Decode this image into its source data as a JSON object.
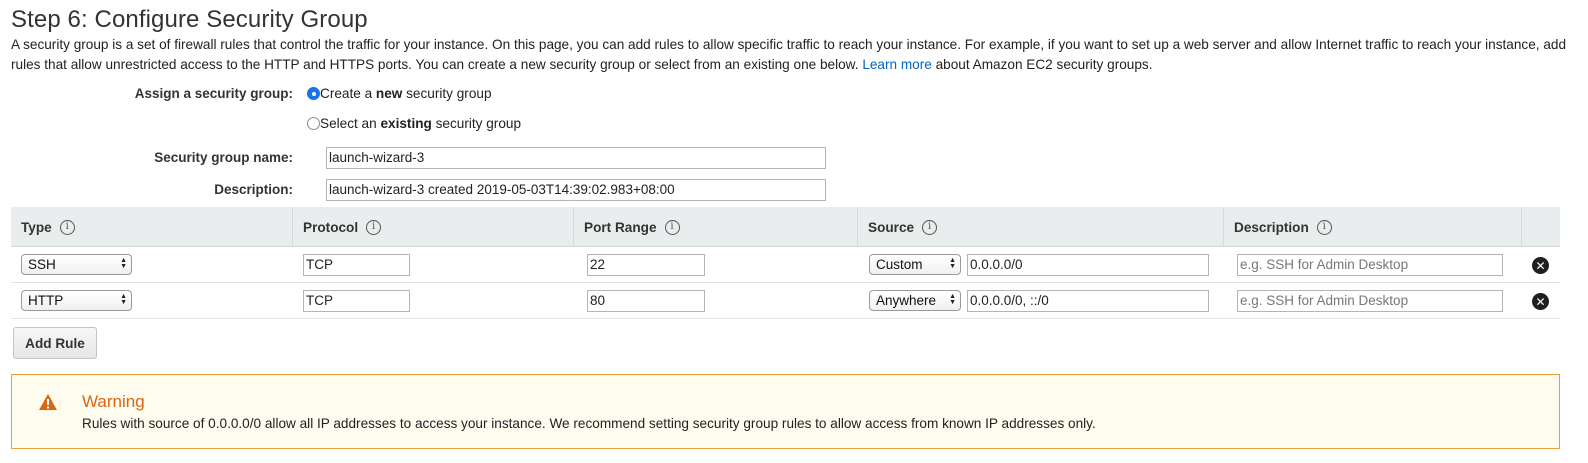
{
  "page": {
    "title": "Step 6: Configure Security Group",
    "intro_text": "A security group is a set of firewall rules that control the traffic for your instance. On this page, you can add rules to allow specific traffic to reach your instance. For example, if you want to set up a web server and allow Internet traffic to reach your instance, add rules that allow unrestricted access to the HTTP and HTTPS ports. You can create a new security group or select from an existing one below.",
    "learn_more_link": "Learn more",
    "intro_suffix": "about Amazon EC2 security groups."
  },
  "form": {
    "assign_label": "Assign a security group:",
    "radio_create_prefix": "Create a ",
    "radio_create_bold": "new",
    "radio_create_suffix": " security group",
    "radio_create_checked": true,
    "radio_existing_prefix": "Select an ",
    "radio_existing_bold": "existing",
    "radio_existing_suffix": " security group",
    "radio_existing_checked": false,
    "name_label": "Security group name:",
    "name_value": "launch-wizard-3",
    "description_label": "Description:",
    "description_value": "launch-wizard-3 created 2019-05-03T14:39:02.983+08:00"
  },
  "table": {
    "headers": {
      "type": "Type",
      "protocol": "Protocol",
      "port_range": "Port Range",
      "source": "Source",
      "description": "Description"
    },
    "info_glyph": "i",
    "rows": [
      {
        "type": "SSH",
        "protocol": "TCP",
        "port_range": "22",
        "source_mode": "Custom",
        "source_value": "0.0.0.0/0",
        "description_placeholder": "e.g. SSH for Admin Desktop"
      },
      {
        "type": "HTTP",
        "protocol": "TCP",
        "port_range": "80",
        "source_mode": "Anywhere",
        "source_value": "0.0.0.0/0, ::/0",
        "description_placeholder": "e.g. SSH for Admin Desktop"
      }
    ],
    "remove_glyph": "✕"
  },
  "add_rule_label": "Add Rule",
  "warning": {
    "title": "Warning",
    "text": "Rules with source of 0.0.0.0/0 allow all IP addresses to access your instance. We recommend setting security group rules to allow access from known IP addresses only.",
    "icon": "warning-triangle-icon",
    "color": "#d86613"
  },
  "colors": {
    "link": "#0066c0",
    "radio_selected": "#1a73e8",
    "table_header_bg": "#eaeded",
    "warning_border": "#eb9d37",
    "warning_bg": "#fefcef"
  }
}
